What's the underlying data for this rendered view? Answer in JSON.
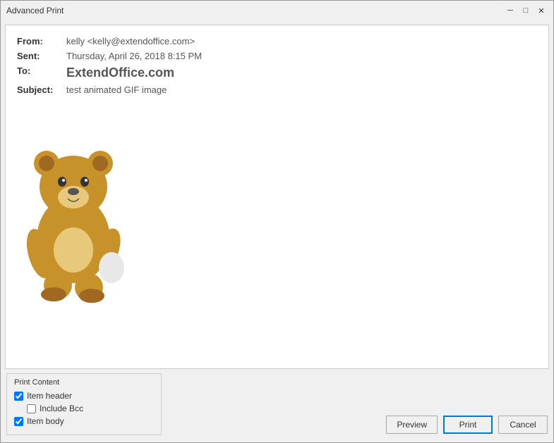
{
  "window": {
    "title": "Advanced Print",
    "minimize_label": "─",
    "maximize_label": "□",
    "close_label": "✕"
  },
  "email": {
    "from_label": "From:",
    "from_value": "kelly <kelly@extendoffice.com>",
    "sent_label": "Sent:",
    "sent_value": "Thursday, April 26, 2018 8:15 PM",
    "to_label": "To:",
    "to_value": "ExtendOffice.com",
    "subject_label": "Subject:",
    "subject_value": "test animated GIF image"
  },
  "print_content": {
    "title": "Print Content",
    "item_header_label": "Item header",
    "item_header_checked": true,
    "include_bcc_label": "Include Bcc",
    "include_bcc_checked": false,
    "item_body_label": "Item body",
    "item_body_checked": true
  },
  "buttons": {
    "preview_label": "Preview",
    "print_label": "Print",
    "cancel_label": "Cancel"
  }
}
